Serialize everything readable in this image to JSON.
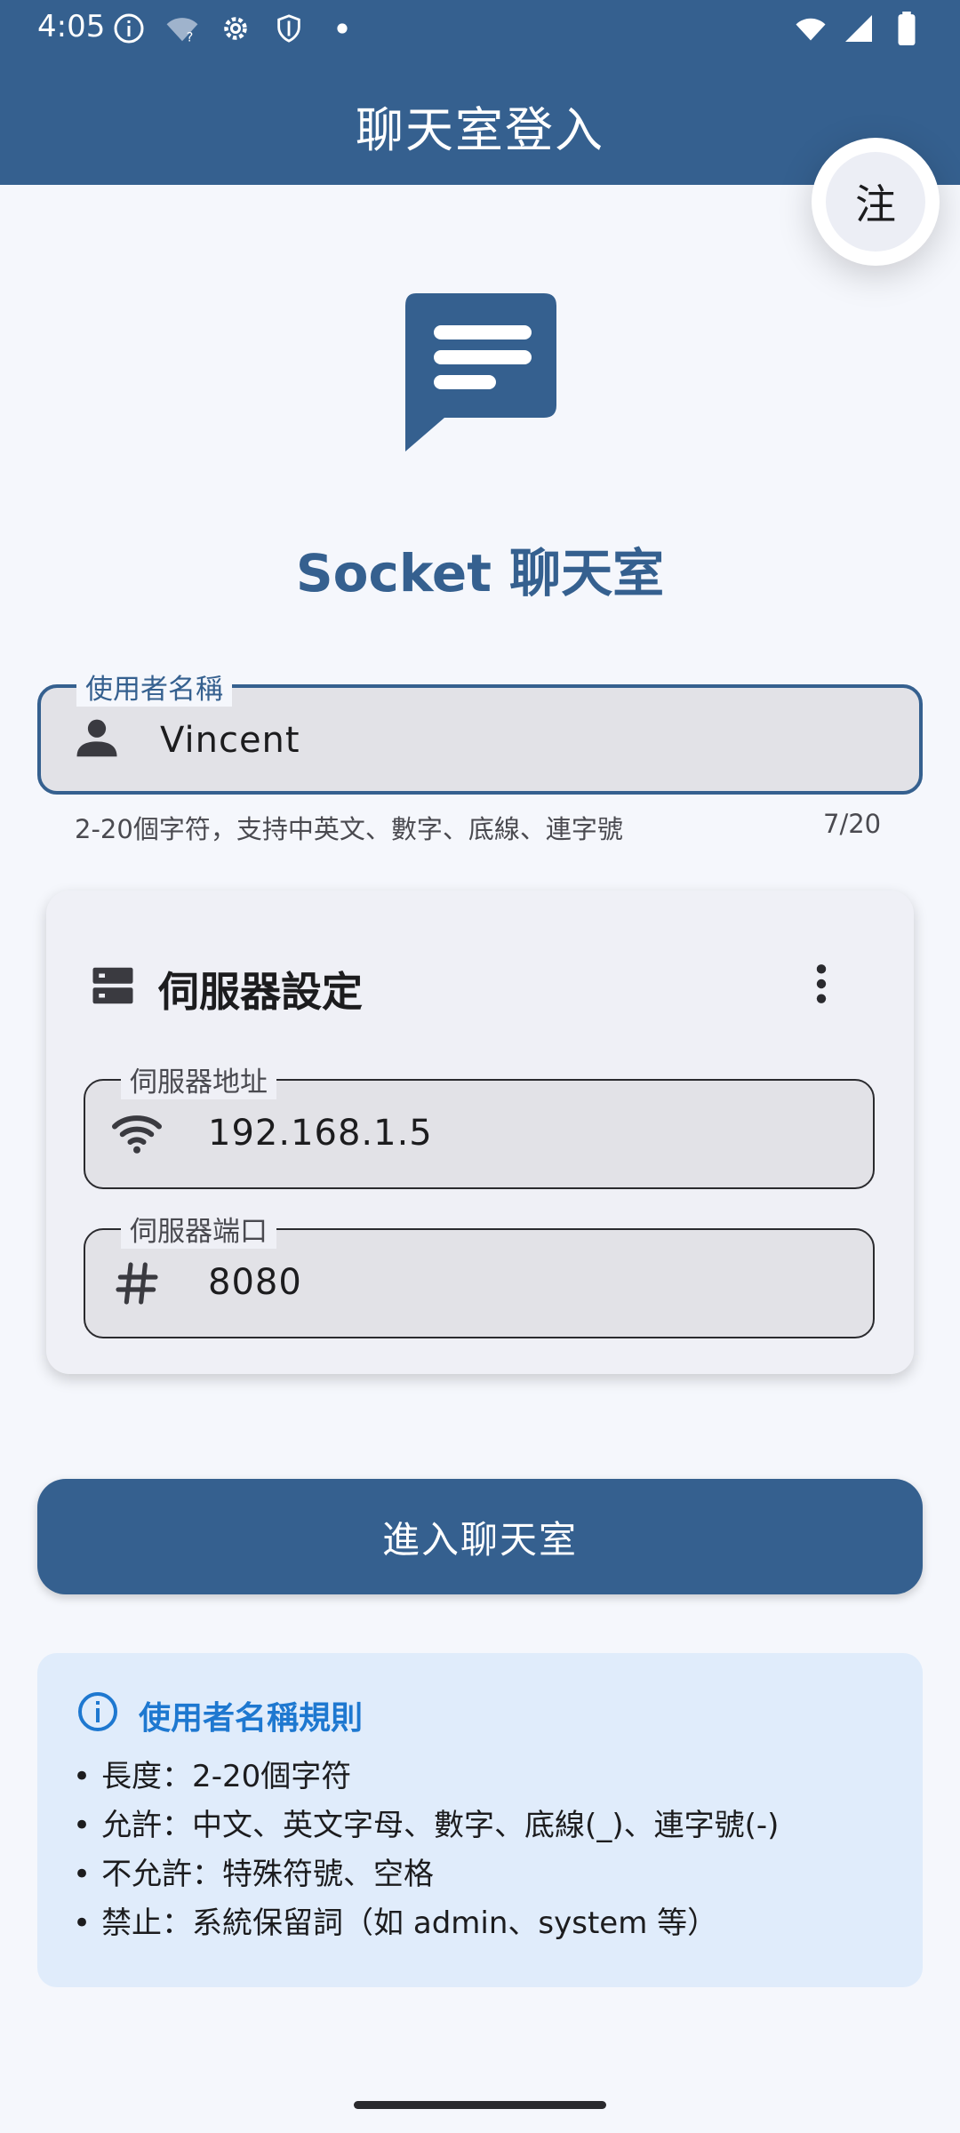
{
  "status_bar": {
    "time": "4:05",
    "icons_left": [
      "info-icon",
      "wifi-question-icon",
      "settings-icon",
      "shield-icon",
      "dot-icon"
    ],
    "icons_right": [
      "wifi-icon",
      "cell-signal-icon",
      "battery-icon"
    ]
  },
  "app_bar": {
    "title": "聊天室登入"
  },
  "fab": {
    "label": "注"
  },
  "app_name": "Socket 聊天室",
  "username": {
    "label": "使用者名稱",
    "value": "Vincent",
    "helper": "2-20個字符，支持中英文、數字、底線、連字號",
    "counter": "7/20",
    "icon": "person-icon"
  },
  "server_card": {
    "title": "伺服器設定",
    "host": {
      "label": "伺服器地址",
      "value": "192.168.1.5",
      "icon": "wifi-icon"
    },
    "port": {
      "label": "伺服器端口",
      "value": "8080",
      "icon": "hash-icon"
    }
  },
  "enter_button": "進入聊天室",
  "rules": {
    "title": "使用者名稱規則",
    "items": [
      "長度：2-20個字符",
      "允許：中文、英文字母、數字、底線(_)、連字號(-)",
      "不允許：特殊符號、空格",
      "禁止：系統保留詞（如 admin、system 等）"
    ]
  },
  "colors": {
    "primary": "#35608f",
    "background": "#f5f7fc",
    "info_background": "#e0ecfb",
    "info_accent": "#1e78d0"
  }
}
